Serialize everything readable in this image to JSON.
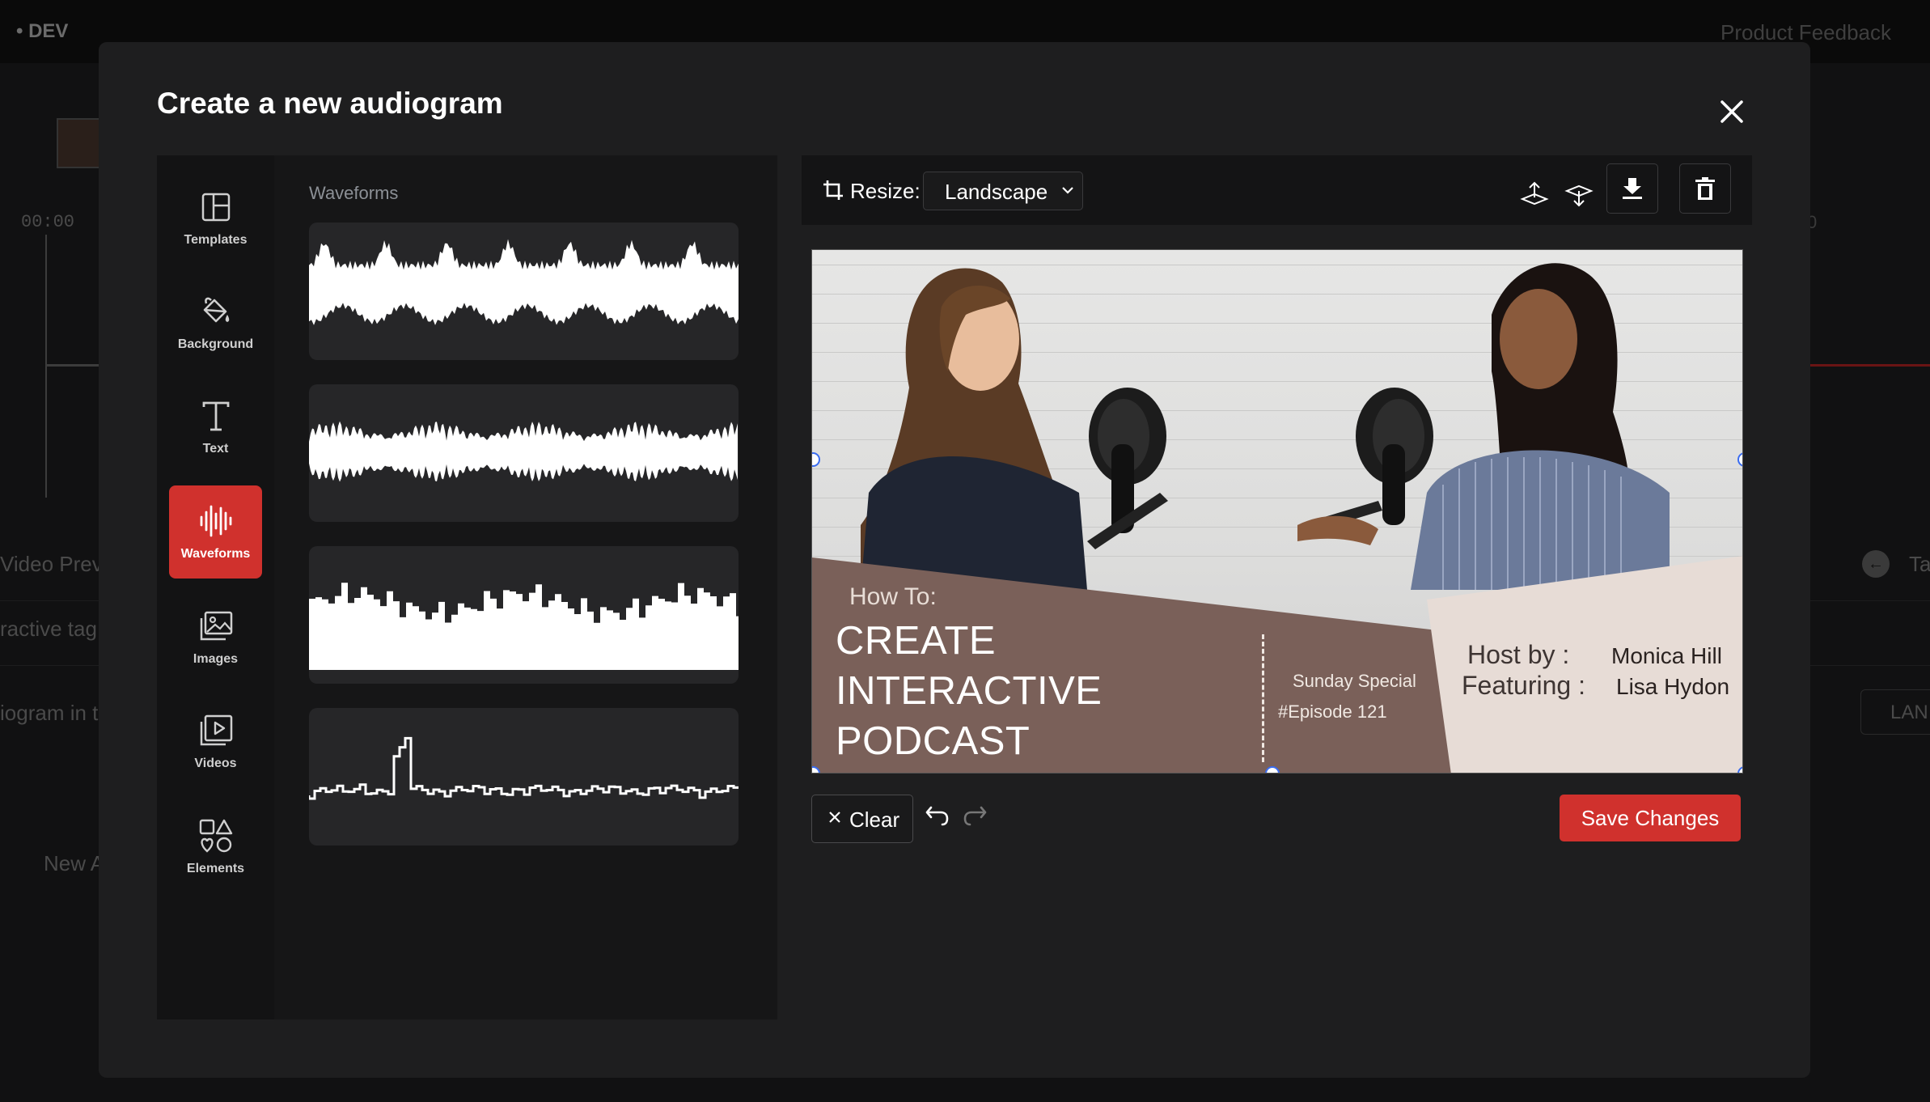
{
  "background": {
    "env_label": "• DEV",
    "feedback_link": "Product Feedback",
    "timecode_left": "00:00",
    "timecode_right": "0",
    "partial_video_preview": "Video Prev",
    "partial_interactive_tags": "ractive tag",
    "partial_audiogram_text": "iogram in th",
    "partial_new": "New A",
    "partial_ta": "Ta",
    "partial_lan": "LAN"
  },
  "modal": {
    "title": "Create a new audiogram",
    "close_icon": "close-icon"
  },
  "sidebar": {
    "items": [
      {
        "label": "Templates",
        "icon": "templates-icon",
        "active": false
      },
      {
        "label": "Background",
        "icon": "paint-bucket-icon",
        "active": false
      },
      {
        "label": "Text",
        "icon": "text-icon",
        "active": false
      },
      {
        "label": "Waveforms",
        "icon": "waveform-icon",
        "active": true
      },
      {
        "label": "Images",
        "icon": "images-icon",
        "active": false
      },
      {
        "label": "Videos",
        "icon": "video-icon",
        "active": false
      },
      {
        "label": "Elements",
        "icon": "shapes-icon",
        "active": false
      }
    ]
  },
  "waveforms": {
    "section_title": "Waveforms",
    "styles": [
      "sine-peaks",
      "dense-bars",
      "step-histogram",
      "line-spike"
    ]
  },
  "toolbar": {
    "resize_label": "Resize:",
    "resize_value": "Landscape",
    "icons": [
      "bring-forward-icon",
      "send-backward-icon",
      "download-icon",
      "trash-icon"
    ]
  },
  "canvas": {
    "how_to": "How To:",
    "title_line1": "CREATE",
    "title_line2": "INTERACTIVE",
    "title_line3": "PODCAST",
    "sunday": "Sunday Special",
    "episode": "#Episode 121",
    "host_label": "Host by   :",
    "featuring_label": "Featuring :",
    "host_name": "Monica Hill",
    "featuring_name": "Lisa Hydon",
    "colors": {
      "brown_panel": "#7a6059",
      "beige_panel": "#e7dcd6"
    }
  },
  "actions": {
    "clear_label": "Clear",
    "save_label": "Save Changes"
  },
  "colors": {
    "accent": "#d0312d",
    "modal_bg": "#1e1e1f",
    "panel_bg": "#161617"
  }
}
